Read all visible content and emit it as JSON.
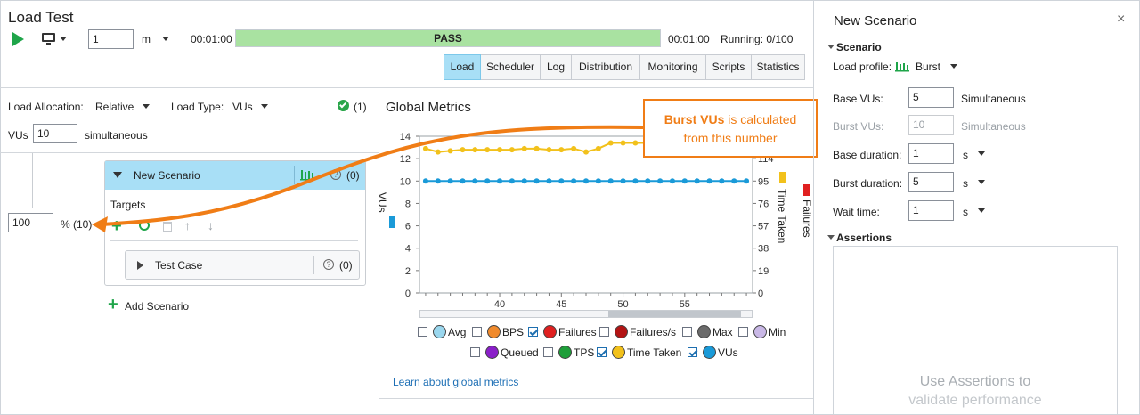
{
  "app": {
    "title": "Load Test"
  },
  "toolbar": {
    "repeat_value": "1",
    "repeat_unit": "m",
    "elapsed": "00:01:00",
    "status": "PASS",
    "total": "00:01:00",
    "running": "Running: 0/100",
    "progress_fraction": 1.0
  },
  "tabs": [
    {
      "label": "Load",
      "active": true
    },
    {
      "label": "Scheduler"
    },
    {
      "label": "Log"
    },
    {
      "label": "Distribution"
    },
    {
      "label": "Monitoring"
    },
    {
      "label": "Scripts"
    },
    {
      "label": "Statistics"
    }
  ],
  "allocation": {
    "load_allocation_label": "Load Allocation:",
    "load_allocation_value": "Relative",
    "load_type_label": "Load Type:",
    "load_type_value": "VUs",
    "check_count": "(1)",
    "vus_label": "VUs",
    "vus_value": "10",
    "vus_suffix": "simultaneous"
  },
  "scenario": {
    "name": "New Scenario",
    "count": "(0)",
    "targets_label": "Targets",
    "percent_value": "100",
    "percent_suffix": "% (10)",
    "test_case": "Test Case",
    "test_case_count": "(0)",
    "add_scenario": "Add Scenario"
  },
  "metrics": {
    "title": "Global Metrics",
    "learn_link": "Learn about global metrics",
    "y_left_label": "VUs",
    "y_right_label": "Time Taken",
    "y_right2_label": "Failures",
    "colors": {
      "vus": "#1a9ad8",
      "time_taken": "#f2c11b",
      "failures": "#e02020"
    },
    "legend": [
      {
        "label": "Avg",
        "color": "#9ad7ee",
        "checked": false
      },
      {
        "label": "BPS",
        "color": "#f08a2c",
        "checked": false
      },
      {
        "label": "Failures",
        "color": "#e02020",
        "checked": true
      },
      {
        "label": "Failures/s",
        "color": "#b31414",
        "checked": false
      },
      {
        "label": "Max",
        "color": "#6b6b6b",
        "checked": false
      },
      {
        "label": "Min",
        "color": "#c9b8e6",
        "checked": false
      },
      {
        "label": "Queued",
        "color": "#8a1fc9",
        "checked": false
      },
      {
        "label": "TPS",
        "color": "#1f9e3a",
        "checked": false
      },
      {
        "label": "Time Taken",
        "color": "#f2c11b",
        "checked": true
      },
      {
        "label": "VUs",
        "color": "#1a9ad8",
        "checked": true
      }
    ]
  },
  "chart_data": {
    "type": "line",
    "x": [
      34,
      35,
      36,
      37,
      38,
      39,
      40,
      41,
      42,
      43,
      44,
      45,
      46,
      47,
      48,
      49,
      50,
      51,
      52,
      53,
      54,
      55,
      56,
      57,
      58,
      59,
      60
    ],
    "xlim": [
      33.5,
      60.5
    ],
    "x_ticks": [
      40,
      45,
      50,
      55
    ],
    "ylim": [
      0,
      14
    ],
    "y_ticks": [
      0,
      2,
      4,
      6,
      8,
      10,
      12,
      14
    ],
    "y_right_ticks": [
      "0",
      "19",
      "38",
      "57",
      "76",
      "95",
      "114",
      "133"
    ],
    "series": [
      {
        "name": "VUs",
        "color": "#1a9ad8",
        "values": [
          10,
          10,
          10,
          10,
          10,
          10,
          10,
          10,
          10,
          10,
          10,
          10,
          10,
          10,
          10,
          10,
          10,
          10,
          10,
          10,
          10,
          10,
          10,
          10,
          10,
          10,
          10
        ]
      },
      {
        "name": "Time Taken",
        "color": "#f2c11b",
        "values": [
          12.9,
          12.6,
          12.7,
          12.8,
          12.8,
          12.8,
          12.8,
          12.8,
          12.9,
          12.9,
          12.8,
          12.8,
          12.9,
          12.6,
          12.9,
          13.4,
          13.4,
          13.4,
          13.4,
          12.8,
          12.8,
          12.8,
          12.8,
          12.8,
          12.8,
          12.8,
          12.8
        ]
      }
    ]
  },
  "callout": {
    "bold": "Burst VUs",
    "rest": " is calculated",
    "line2": "from this number"
  },
  "panel": {
    "title": "New Scenario",
    "section_scenario": "Scenario",
    "load_profile_label": "Load profile:",
    "load_profile_value": "Burst",
    "base_vus_label": "Base VUs:",
    "base_vus_value": "5",
    "base_vus_suffix": "Simultaneous",
    "burst_vus_label": "Burst VUs:",
    "burst_vus_value": "10",
    "burst_vus_suffix": "Simultaneous",
    "base_duration_label": "Base duration:",
    "base_duration_value": "1",
    "base_duration_unit": "s",
    "burst_duration_label": "Burst duration:",
    "burst_duration_value": "5",
    "burst_duration_unit": "s",
    "wait_time_label": "Wait time:",
    "wait_time_value": "1",
    "wait_time_unit": "s",
    "section_assertions": "Assertions",
    "assertions_hint_1": "Use Assertions to",
    "assertions_hint_2": "validate performance"
  }
}
